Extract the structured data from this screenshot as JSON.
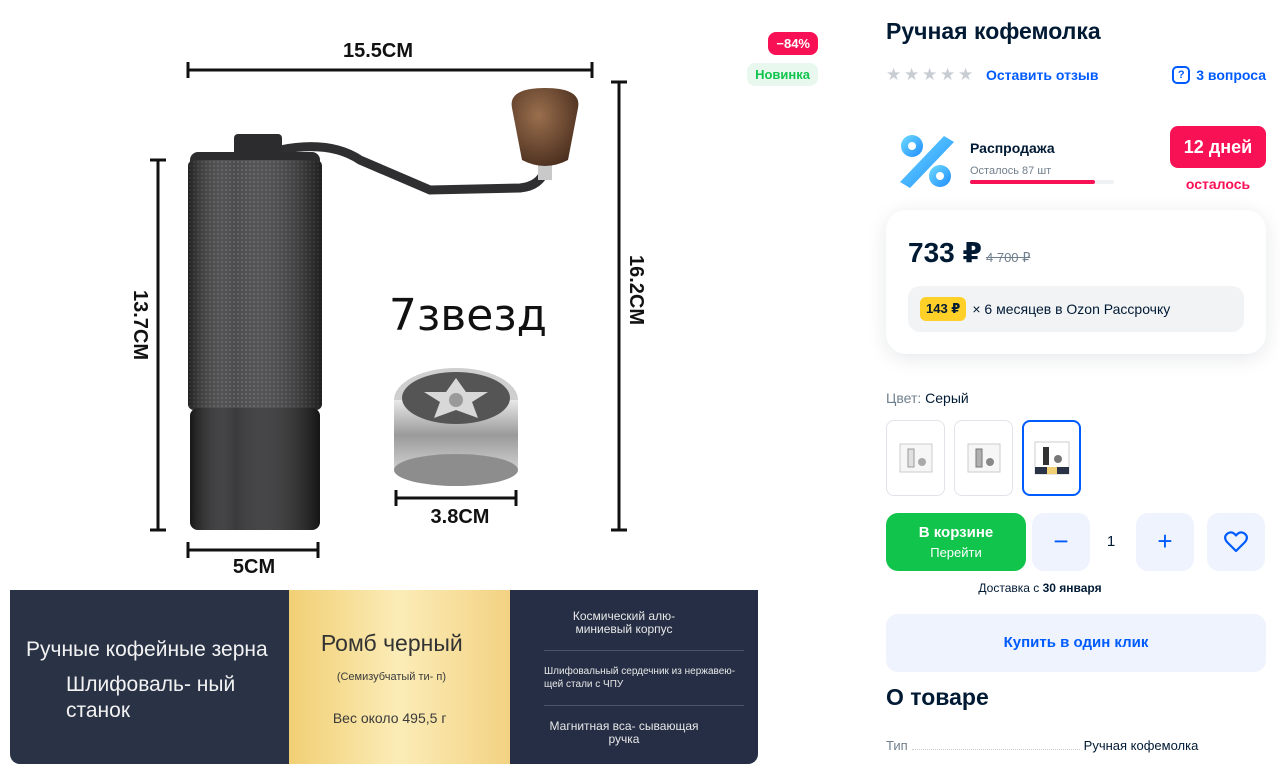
{
  "gallery": {
    "badges": {
      "discount": "−84%",
      "new": "Новинка"
    },
    "image": {
      "dim_top": "15.5CM",
      "dim_left": "13.7CM",
      "dim_right": "16.2CM",
      "dim_bottom": "5CM",
      "dim_burr": "3.8CM",
      "overlay_text": "7звезд"
    },
    "strip": {
      "left_line1": "Ручные кофейные зерна",
      "left_line2": "Шлифоваль- ный станок",
      "mid_title": "Ромб черный",
      "mid_sub": "(Семизубчатый ти- п)",
      "mid_weight": "Вес около 495,5 г",
      "right_line1": "Космический алю- миниевый корпус",
      "right_line2": "Шлифовальный сердечник из нержавею- щей стали с ЧПУ",
      "right_line3": "Магнитная вса- сывающая ручка"
    }
  },
  "product": {
    "title": "Ручная кофемолка",
    "review_link": "Оставить отзыв",
    "questions": "3 вопроса"
  },
  "sale": {
    "title": "Распродажа",
    "left_text": "Осталось 87 шт",
    "bar_fill_fraction": 0.87,
    "days_badge": "12 дней",
    "days_sub": "осталось"
  },
  "price": {
    "current": "733 ₽",
    "old": "4 700 ₽",
    "installment_badge": "143 ₽",
    "installment_text": "× 6 месяцев в Ozon Рассрочку"
  },
  "color": {
    "label": "Цвет:",
    "value": "Серый"
  },
  "cart": {
    "btn_title": "В корзине",
    "btn_sub": "Перейти",
    "minus": "−",
    "qty": "1",
    "plus": "+"
  },
  "delivery": {
    "prefix": "Доставка с",
    "date": "30 января"
  },
  "oneclick": "Купить в один клик",
  "about": {
    "title": "О товаре",
    "spec_key": "Тип",
    "spec_value": "Ручная кофемолка"
  },
  "colors": {
    "accent": "#005bff",
    "sale": "#f91155",
    "green": "#10c44c"
  }
}
